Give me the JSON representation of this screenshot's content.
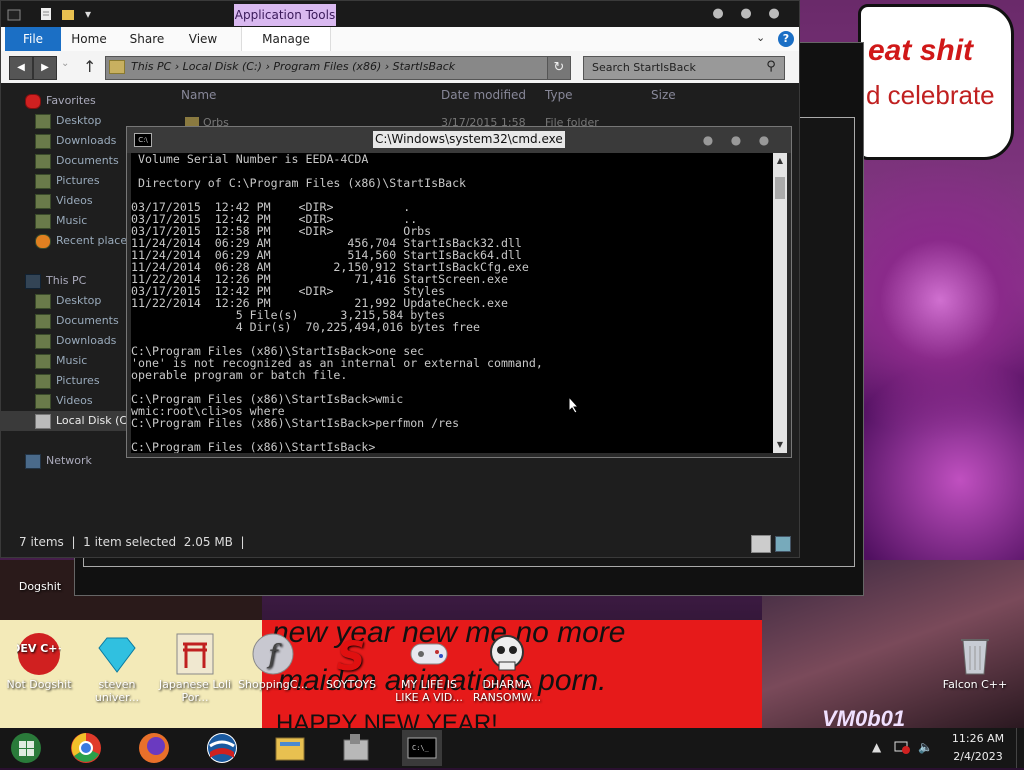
{
  "wallpaper": {
    "bubble_line1": "eat shit",
    "bubble_line2": "d celebrate",
    "banner_line1": "new year new me no more",
    "banner_line2": "maiden animations porn.",
    "banner_line3": "HAPPY NEW YEAR!",
    "crowd_text": "VM0b01"
  },
  "explorer": {
    "quick_access": [
      "properties-icon",
      "new-folder-icon"
    ],
    "app_tools_label": "Application Tools",
    "ribbon_tabs": {
      "file": "File",
      "home": "Home",
      "share": "Share",
      "view": "View",
      "manage": "Manage"
    },
    "address": "This PC  ›  Local Disk (C:)  ›  Program Files (x86)  ›  StartIsBack",
    "search_placeholder": "Search StartIsBack",
    "nav": {
      "favorites": "Favorites",
      "fav_items": [
        "Desktop",
        "Downloads",
        "Documents",
        "Pictures",
        "Videos",
        "Music",
        "Recent places"
      ],
      "this_pc": "This PC",
      "pc_items": [
        "Desktop",
        "Documents",
        "Downloads",
        "Music",
        "Pictures",
        "Videos",
        "Local Disk (C:)"
      ],
      "network": "Network"
    },
    "columns": {
      "name": "Name",
      "date": "Date modified",
      "type": "Type",
      "size": "Size"
    },
    "row": {
      "name": "Orbs",
      "date": "3/17/2015 1:58",
      "type": "File folder"
    },
    "status": {
      "items": "7 items",
      "selected": "1 item selected  2.05 MB"
    }
  },
  "cmd": {
    "title": "C:\\Windows\\system32\\cmd.exe",
    "lines": [
      " Volume Serial Number is EEDA-4CDA",
      "",
      " Directory of C:\\Program Files (x86)\\StartIsBack",
      "",
      "03/17/2015  12:42 PM    <DIR>          .",
      "03/17/2015  12:42 PM    <DIR>          ..",
      "03/17/2015  12:58 PM    <DIR>          Orbs",
      "11/24/2014  06:29 AM           456,704 StartIsBack32.dll",
      "11/24/2014  06:29 AM           514,560 StartIsBack64.dll",
      "11/24/2014  06:28 AM         2,150,912 StartIsBackCfg.exe",
      "11/22/2014  12:26 PM            71,416 StartScreen.exe",
      "03/17/2015  12:42 PM    <DIR>          Styles",
      "11/22/2014  12:26 PM            21,992 UpdateCheck.exe",
      "               5 File(s)      3,215,584 bytes",
      "               4 Dir(s)  70,225,494,016 bytes free",
      "",
      "C:\\Program Files (x86)\\StartIsBack>one sec",
      "'one' is not recognized as an internal or external command,",
      "operable program or batch file.",
      "",
      "C:\\Program Files (x86)\\StartIsBack>wmic",
      "wmic:root\\cli>os where",
      "C:\\Program Files (x86)\\StartIsBack>perfmon /res",
      "",
      "C:\\Program Files (x86)\\StartIsBack>"
    ]
  },
  "desktop": {
    "icons": [
      {
        "label": "Dogshit"
      },
      {
        "label": "Not Dogshit"
      },
      {
        "label": "steven univer..."
      },
      {
        "label": "Japanese Loli Por..."
      },
      {
        "label": "ShoppingC..."
      },
      {
        "label": "SOYTOYS"
      },
      {
        "label": "MY LIFE IS LIKE A VID..."
      },
      {
        "label": "DHARMA RANSOMW..."
      },
      {
        "label": "Falcon C++"
      }
    ],
    "devcpp_badge": "DEV C++"
  },
  "taskbar": {
    "time": "11:26 AM",
    "date": "2/4/2023"
  },
  "colors": {
    "file_tab": "#1b6fc5",
    "app_tools": "#d9b9f0",
    "cmd_bg": "#000000",
    "cmd_fg": "#c8c8c8"
  }
}
